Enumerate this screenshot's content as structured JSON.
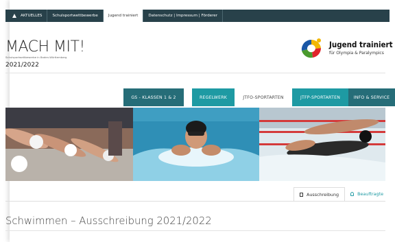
{
  "topnav": {
    "items": [
      "AKTUELLES",
      "Schulsportwettbewerbe",
      "Jugend trainiert",
      "Datenschutz | Impressum | Förderer"
    ],
    "active_index": 2
  },
  "brand": {
    "title": "MACH MIT!",
    "subtitle": "Schulsportwettbewerbe in Baden-Württemberg",
    "year": "2021/2022"
  },
  "partner_logo": {
    "title": "Jugend trainiert",
    "subtitle": "für Olympia & Paralympics"
  },
  "mainnav": {
    "items": [
      "GS - KLASSEN 1 & 2",
      "REGELWERK",
      "JTFO-SPORTARTEN",
      "JTFP-SPORTARTEN",
      "INFO & SERVICE"
    ],
    "active_index": 2
  },
  "content_tabs": {
    "items": [
      "Ausschreibung",
      "Beauftragte"
    ],
    "active_index": 0
  },
  "page": {
    "heading": "Schwimmen – Ausschreibung 2021/2022"
  },
  "colors": {
    "topnav_bg": "#28414a",
    "accent_teal": "#1e9aa3",
    "dark_teal": "#266d78"
  }
}
